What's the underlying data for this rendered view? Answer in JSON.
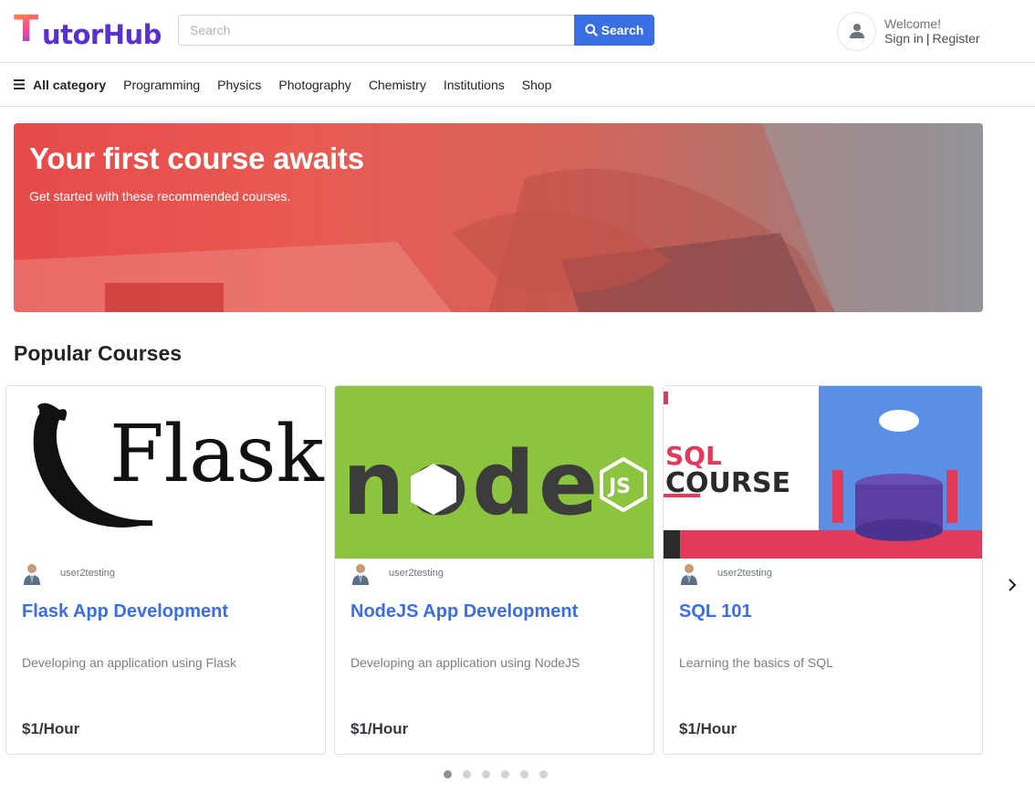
{
  "header": {
    "logo": {
      "first_letter": "T",
      "rest": "utorHub"
    },
    "search": {
      "placeholder": "Search",
      "button_label": "Search"
    },
    "user": {
      "welcome": "Welcome!",
      "sign_in": "Sign in",
      "separator": "|",
      "register": "Register"
    }
  },
  "nav": {
    "all_category": "All category",
    "items": [
      "Programming",
      "Physics",
      "Photography",
      "Chemistry",
      "Institutions",
      "Shop"
    ]
  },
  "banner": {
    "title": "Your first course awaits",
    "subtitle": "Get started with these recommended courses."
  },
  "popular": {
    "title": "Popular Courses",
    "courses": [
      {
        "author": "user2testing",
        "title": "Flask App Development",
        "description": "Developing an application using Flask",
        "price": "$1/Hour",
        "image_text": "Flask"
      },
      {
        "author": "user2testing",
        "title": "NodeJS App Development",
        "description": "Developing an application using NodeJS",
        "price": "$1/Hour",
        "image_text": "node"
      },
      {
        "author": "user2testing",
        "title": "SQL 101",
        "description": "Learning the basics of SQL",
        "price": "$1/Hour",
        "image_text_1": "SQL",
        "image_text_2": "COURSE"
      }
    ],
    "pagination_dots": 6,
    "active_dot": 1
  },
  "colors": {
    "brand_blue": "#3b6ee0",
    "banner_red": "#e64a4a",
    "node_green": "#8cc43f",
    "sql_pink": "#e23a5a",
    "sql_blue": "#5b8fe6"
  }
}
